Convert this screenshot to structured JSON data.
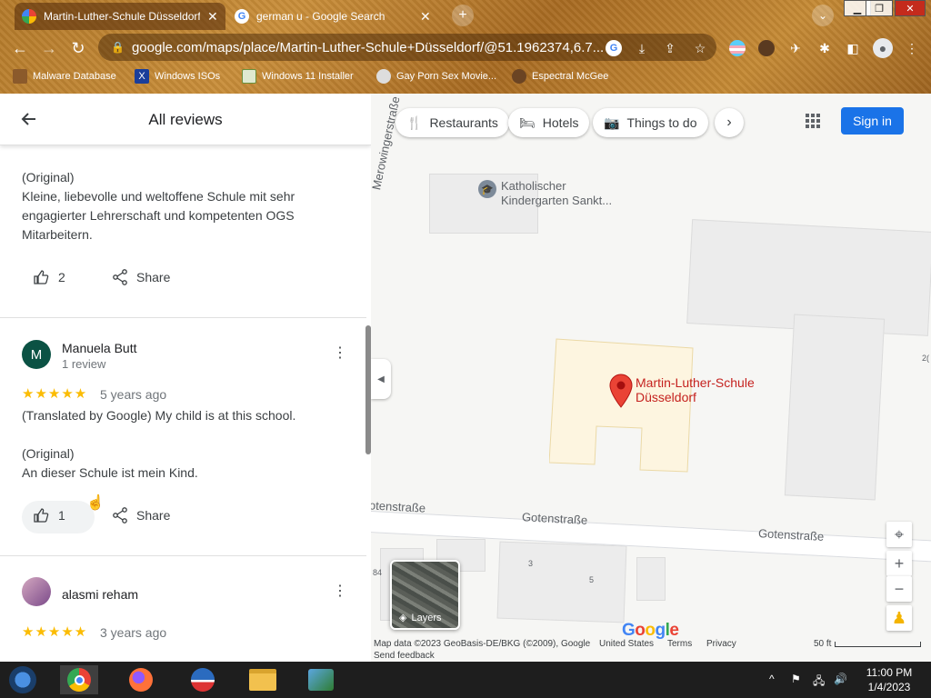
{
  "browser": {
    "tabs": [
      {
        "title": "Martin-Luther-Schule Düsseldorf",
        "active": true
      },
      {
        "title": "german u - Google Search",
        "active": false
      }
    ],
    "new_tab_label": "+",
    "url": "google.com/maps/place/Martin-Luther-Schule+Düsseldorf/@51.1962374,6.7...",
    "bookmarks": [
      {
        "label": "Malware Database"
      },
      {
        "label": "Windows ISOs"
      },
      {
        "label": "Windows 11 Installer"
      },
      {
        "label": "Gay Porn Sex Movie..."
      },
      {
        "label": "Espectral McGee"
      }
    ]
  },
  "panel": {
    "title": "All reviews",
    "review1": {
      "original_label": "(Original)",
      "original_text": "Kleine, liebevolle und weltoffene Schule mit sehr engagierter Lehrerschaft und kompetenten OGS Mitarbeitern.",
      "likes": "2",
      "share_label": "Share"
    },
    "review2": {
      "avatar_letter": "M",
      "name": "Manuela Butt",
      "review_count": "1 review",
      "rating": 5,
      "stars": "★★★★★",
      "age": "5 years ago",
      "translated_text": "(Translated by Google) My child is at this school.",
      "original_label": "(Original)",
      "original_text": "An dieser Schule ist mein Kind.",
      "likes": "1",
      "share_label": "Share"
    },
    "review3": {
      "name": "alasmi reham",
      "rating": 5,
      "stars": "★★★★★",
      "age": "3 years ago"
    }
  },
  "map": {
    "chips": [
      {
        "label": "Restaurants",
        "icon": "fork-knife-icon"
      },
      {
        "label": "Hotels",
        "icon": "bed-icon"
      },
      {
        "label": "Things to do",
        "icon": "camera-icon"
      }
    ],
    "sign_in": "Sign in",
    "place_label_line1": "Martin-Luther-Schule",
    "place_label_line2": "Düsseldorf",
    "poi_line1": "Katholischer",
    "poi_line2": "Kindergarten Sankt...",
    "streets": {
      "merowinger": "Merowingerstraße",
      "goten_left": "otenstraße",
      "goten_mid": "Gotenstraße",
      "goten_right": "Gotenstraße"
    },
    "house_numbers": [
      "3",
      "5",
      "84",
      "2("
    ],
    "layers_label": "Layers",
    "footer": {
      "map_data": "Map data ©2023 GeoBasis-DE/BKG (©2009), Google",
      "united_states": "United States",
      "terms": "Terms",
      "privacy": "Privacy",
      "send_feedback": "Send feedback",
      "scale": "50 ft"
    },
    "colors": {
      "pin": "#ea4335",
      "place_label": "#c5221f",
      "school_area": "#fdf5e0",
      "button_blue": "#1a73e8",
      "star": "#fbbc04"
    }
  },
  "taskbar": {
    "time": "11:00 PM",
    "date": "1/4/2023"
  }
}
